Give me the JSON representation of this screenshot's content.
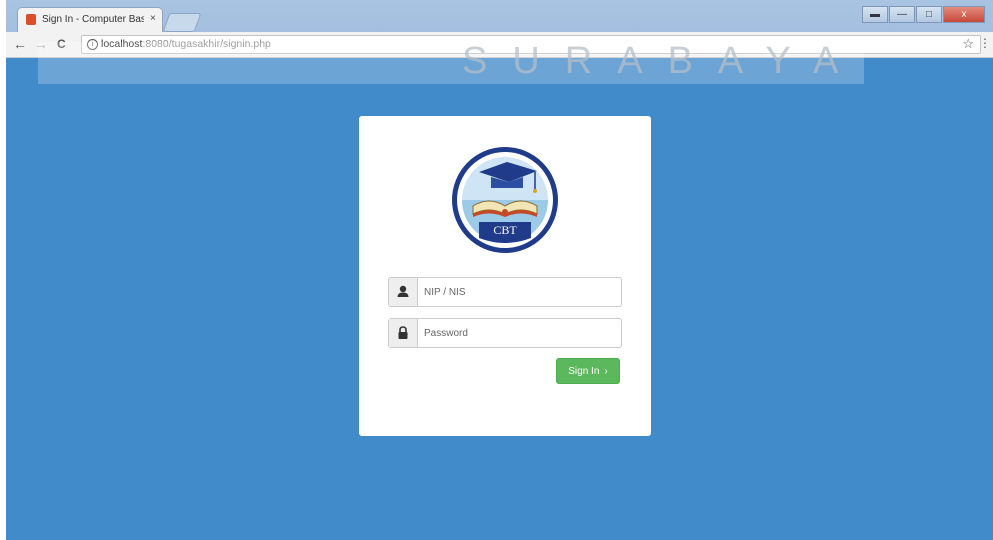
{
  "browser": {
    "tab_title": "Sign In - Computer Base",
    "tab_close": "×",
    "url_host": "localhost",
    "url_path": ":8080/tugasakhir/signin.php",
    "back": "←",
    "forward": "→",
    "reload": "C",
    "info": "i",
    "star": "☆",
    "menu": "⋮",
    "win_minimize_alt": "▬",
    "win_minimize": "—",
    "win_maximize": "□",
    "win_close": "x"
  },
  "watermark": {
    "text": "SURABAYA"
  },
  "logo": {
    "acronym": "CBT"
  },
  "form": {
    "username_placeholder": "NIP / NIS",
    "password_placeholder": "Password",
    "submit_label": "Sign In",
    "submit_chevron": "›"
  },
  "colors": {
    "page_background": "#428bca",
    "card_background": "#ffffff",
    "button": "#5cb85c",
    "logo_ring": "#1f3b8a"
  },
  "icons": {
    "username": "user-icon",
    "password": "lock-icon"
  }
}
